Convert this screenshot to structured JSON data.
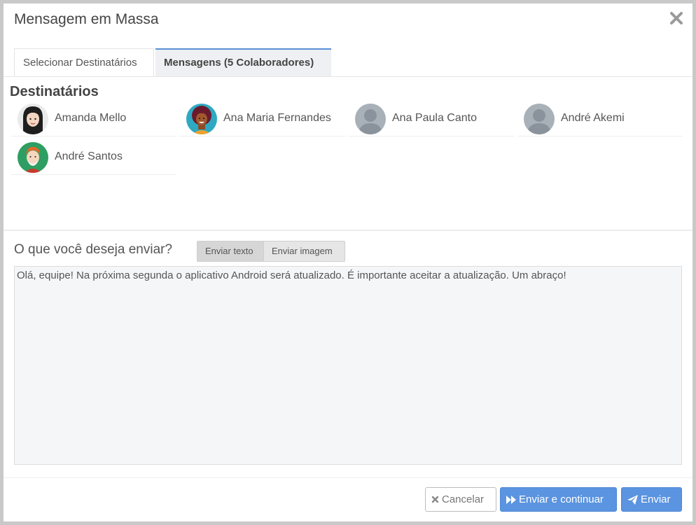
{
  "modal": {
    "title": "Mensagem em Massa",
    "close_icon": "close-icon"
  },
  "tabs": [
    {
      "label": "Selecionar Destinatários",
      "active": false
    },
    {
      "label": "Mensagens (5 Colaboradores)",
      "active": true
    }
  ],
  "recipients": {
    "title": "Destinatários",
    "items": [
      {
        "name": "Amanda Mello",
        "avatar": "avatar-woman-dark-hair"
      },
      {
        "name": "Ana Maria Fernandes",
        "avatar": "avatar-woman-curly-hair"
      },
      {
        "name": "Ana Paula Canto",
        "avatar": "avatar-placeholder"
      },
      {
        "name": "André Akemi",
        "avatar": "avatar-placeholder"
      },
      {
        "name": "André Santos",
        "avatar": "avatar-man-red-hair"
      }
    ]
  },
  "compose": {
    "question": "O que você deseja enviar?",
    "options": [
      "Enviar texto",
      "Enviar imagem"
    ],
    "selected": "Enviar texto",
    "message": "Olá, equipe! Na próxima segunda o aplicativo Android será atualizado. É importante aceitar a atualização. Um abraço!"
  },
  "footer": {
    "cancel_label": "Cancelar",
    "continue_label": "Enviar e continuar",
    "send_label": "Enviar"
  },
  "colors": {
    "primary": "#5b94e0",
    "tab_accent": "#5a8fd6"
  }
}
